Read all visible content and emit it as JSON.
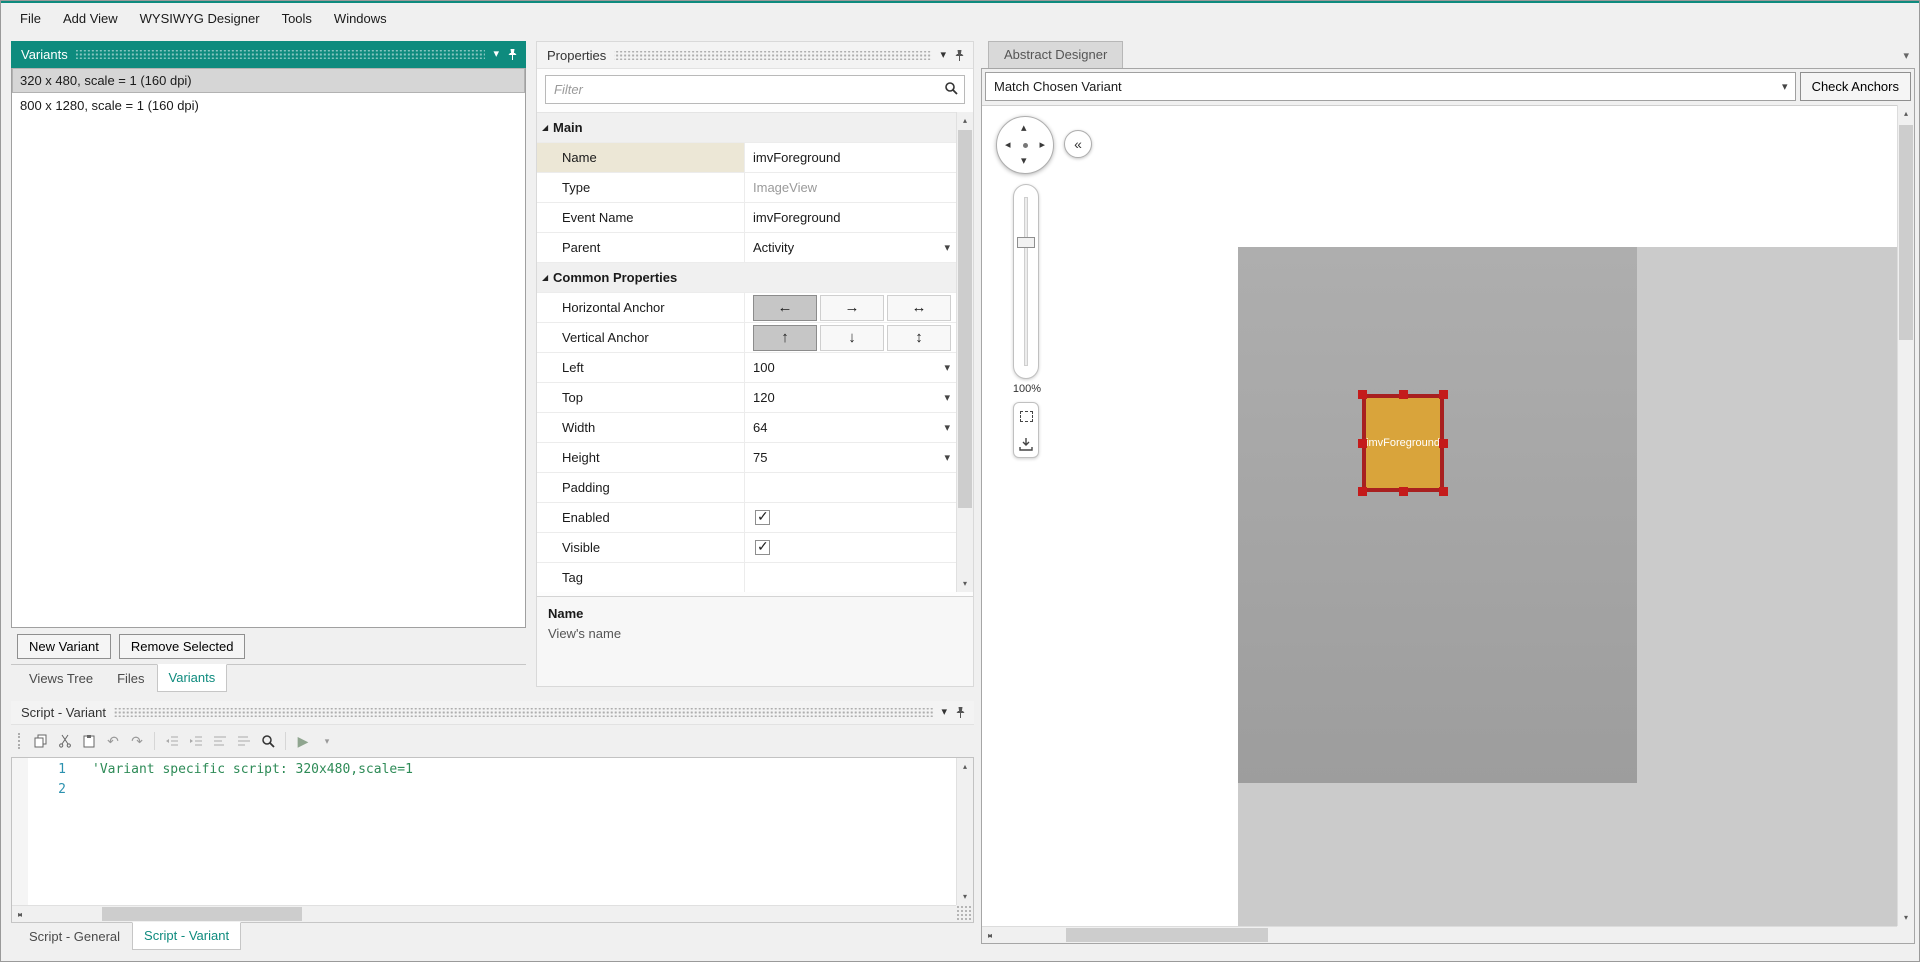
{
  "menu": {
    "items": [
      "File",
      "Add View",
      "WYSIWYG Designer",
      "Tools",
      "Windows"
    ]
  },
  "icons": {
    "chevron_down": "▾",
    "arrow_left": "←",
    "arrow_right": "→",
    "arrow_lr": "↔",
    "arrow_up": "↑",
    "arrow_down": "↓",
    "arrow_ud": "↕",
    "undo": "↶",
    "redo": "↷",
    "play": "▶",
    "collapse": "«",
    "tri_up": "▴",
    "tri_down": "▾",
    "tri_left": "◂",
    "tri_right": "▸",
    "expander": "◢"
  },
  "variants_panel": {
    "title": "Variants",
    "items": [
      {
        "label": "320 x 480, scale = 1 (160 dpi)",
        "selected": true
      },
      {
        "label": "800 x 1280, scale = 1 (160 dpi)",
        "selected": false
      }
    ],
    "buttons": {
      "new_variant": "New Variant",
      "remove_selected": "Remove Selected"
    },
    "tabs": [
      {
        "label": "Views Tree",
        "active": false
      },
      {
        "label": "Files",
        "active": false
      },
      {
        "label": "Variants",
        "active": true
      }
    ]
  },
  "properties_panel": {
    "title": "Properties",
    "filter_placeholder": "Filter",
    "groups": [
      {
        "label": "Main",
        "rows": [
          {
            "label": "Name",
            "value": "imvForeground",
            "type": "text"
          },
          {
            "label": "Type",
            "value": "ImageView",
            "type": "readonly"
          },
          {
            "label": "Event Name",
            "value": "imvForeground",
            "type": "text"
          },
          {
            "label": "Parent",
            "value": "Activity",
            "type": "dropdown"
          }
        ]
      },
      {
        "label": "Common Properties",
        "rows": [
          {
            "label": "Horizontal Anchor",
            "type": "anchor",
            "selected": "left"
          },
          {
            "label": "Vertical Anchor",
            "type": "anchor",
            "selected": "top"
          },
          {
            "label": "Left",
            "value": "100",
            "type": "dropdown"
          },
          {
            "label": "Top",
            "value": "120",
            "type": "dropdown"
          },
          {
            "label": "Width",
            "value": "64",
            "type": "dropdown"
          },
          {
            "label": "Height",
            "value": "75",
            "type": "dropdown"
          },
          {
            "label": "Padding",
            "value": "",
            "type": "text"
          },
          {
            "label": "Enabled",
            "type": "checkbox",
            "checked": true
          },
          {
            "label": "Visible",
            "type": "checkbox",
            "checked": true
          },
          {
            "label": "Tag",
            "value": "",
            "type": "text"
          }
        ]
      }
    ],
    "description": {
      "title": "Name",
      "text": "View's name"
    }
  },
  "script_panel": {
    "title": "Script - Variant",
    "toolbar_icons": [
      "copy",
      "cut",
      "paste",
      "undo",
      "redo",
      "outdent",
      "indent",
      "comment",
      "uncomment",
      "search",
      "run"
    ],
    "lines": [
      {
        "num": "1",
        "code": "'Variant specific script: 320x480,scale=1"
      },
      {
        "num": "2",
        "code": ""
      }
    ],
    "tabs": [
      {
        "label": "Script - General",
        "active": false
      },
      {
        "label": "Script - Variant",
        "active": true
      }
    ]
  },
  "designer": {
    "tab_label": "Abstract Designer",
    "variant_selector": "Match Chosen Variant",
    "check_anchors_label": "Check Anchors",
    "zoom_value": "100%",
    "selected_view_label": "imvForeground"
  },
  "colors": {
    "accent_teal": "#0E8B7E",
    "selected_view_fill": "#D9A43B",
    "selected_view_border": "#A82020",
    "selection_handle": "#C41B1B",
    "screen_gray": "#A3A3A3",
    "canvas_gray": "#CBCBCB",
    "comment_green": "#2E8B57",
    "line_number_blue": "#2B91AF"
  }
}
